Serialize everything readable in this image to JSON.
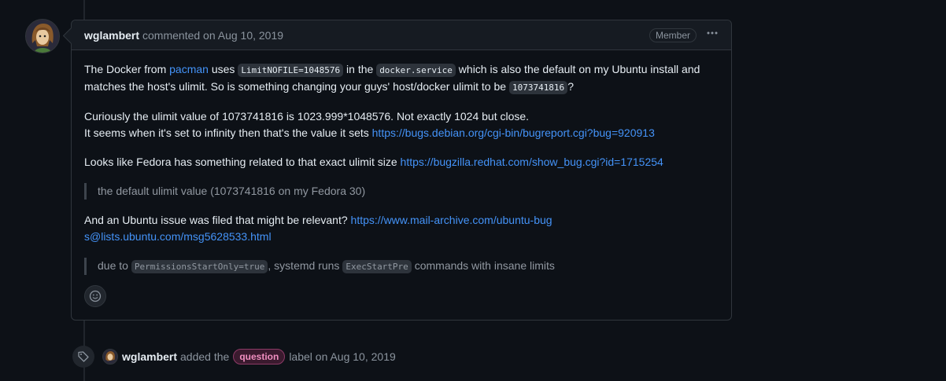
{
  "comment": {
    "author": "wglambert",
    "action": "commented on Aug 10, 2019",
    "role_badge": "Member",
    "p1": {
      "t1": "The Docker from ",
      "link": "pacman",
      "t2": " uses ",
      "code1": "LimitNOFILE=1048576",
      "t3": " in the ",
      "code2": "docker.service",
      "t4": " which is also the default on my Ubuntu install and matches the host's ulimit. So is something changing your guys' host/docker ulimit to be ",
      "code3": "1073741816",
      "t5": "?"
    },
    "p2": {
      "line1": "Curiously the ulimit value of 1073741816 is 1023.999*1048576. Not exactly 1024 but close.",
      "line2": "It seems when it's set to infinity then that's the value it sets ",
      "link": "https://bugs.debian.org/cgi-bin/bugreport.cgi?bug=920913"
    },
    "p3": {
      "text": "Looks like Fedora has something related to that exact ulimit size ",
      "link": "https://bugzilla.redhat.com/show_bug.cgi?id=1715254"
    },
    "quote1": "the default ulimit value (1073741816 on my Fedora 30)",
    "p4": {
      "text": "And an Ubuntu issue was filed that might be relevant? ",
      "link": "https://www.mail-archive.com/ubuntu-bugs@lists.ubuntu.com/msg5628533.html"
    },
    "quote2": {
      "t1": "due to ",
      "code1": "PermissionsStartOnly=true",
      "t2": ", systemd runs ",
      "code2": "ExecStartPre",
      "t3": " commands with insane limits"
    }
  },
  "event": {
    "author": "wglambert",
    "action_before": "added the",
    "label": "question",
    "action_after": "label on Aug 10, 2019"
  },
  "icons": {
    "kebab": "kebab-horizontal-icon",
    "emoji": "smiley-icon",
    "tag": "tag-icon"
  }
}
